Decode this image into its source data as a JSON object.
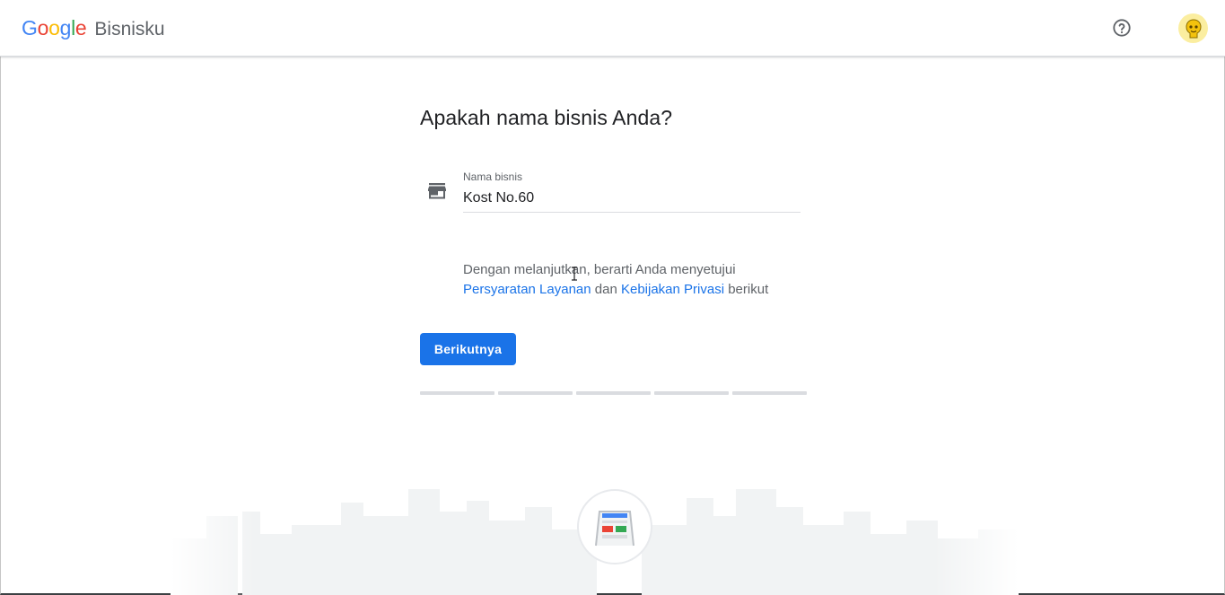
{
  "header": {
    "logo_text": "Google",
    "product_name": "Bisnisku",
    "help_icon": "help-circle-icon",
    "avatar_icon": "account-avatar-icon"
  },
  "main": {
    "title": "Apakah nama bisnis Anda?",
    "business_field": {
      "icon": "store-icon",
      "label": "Nama bisnis",
      "value": "Kost No.60"
    },
    "consent": {
      "prefix": "Dengan melanjutkan, berarti Anda menyetujui",
      "terms_link": "Persyaratan Layanan",
      "connector": "dan",
      "privacy_link": "Kebijakan Privasi",
      "suffix": "berikut"
    },
    "next_button": "Berikutnya",
    "progress_steps": 5,
    "progress_completed": 0
  },
  "colors": {
    "primary": "#1a73e8",
    "text": "#202124",
    "secondary_text": "#5f6368",
    "divider": "#dadce0"
  }
}
